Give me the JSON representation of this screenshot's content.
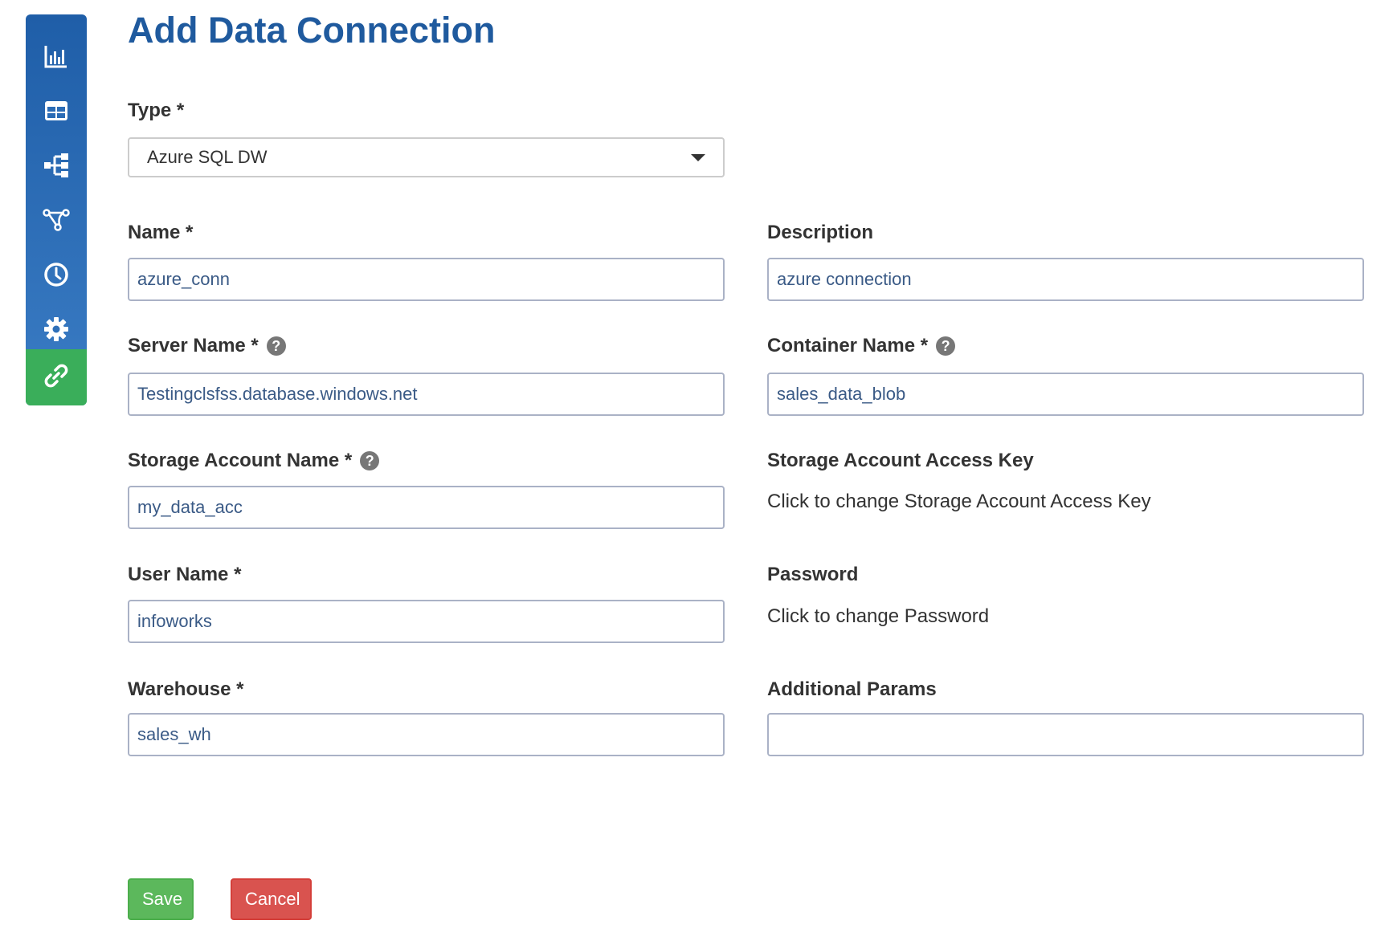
{
  "sidebar": {
    "items": [
      {
        "icon": "bar-chart-icon"
      },
      {
        "icon": "table-icon"
      },
      {
        "icon": "hierarchy-icon"
      },
      {
        "icon": "pipeline-icon"
      },
      {
        "icon": "clock-icon"
      },
      {
        "icon": "gear-icon"
      },
      {
        "icon": "link-icon",
        "active": true
      }
    ]
  },
  "page": {
    "title": "Add Data Connection"
  },
  "form": {
    "type_label": "Type *",
    "type_value": "Azure SQL DW",
    "name_label": "Name *",
    "name_value": "azure_conn",
    "description_label": "Description",
    "description_value": "azure connection",
    "server_name_label": "Server Name *",
    "server_name_value": "Testingclsfss.database.windows.net",
    "container_name_label": "Container Name *",
    "container_name_value": "sales_data_blob",
    "storage_account_name_label": "Storage Account Name *",
    "storage_account_name_value": "my_data_acc",
    "storage_access_key_label": "Storage Account Access Key",
    "storage_access_key_link": "Click to change Storage Account Access Key",
    "user_name_label": "User Name *",
    "user_name_value": "infoworks",
    "password_label": "Password",
    "password_link": "Click to change Password",
    "warehouse_label": "Warehouse *",
    "warehouse_value": "sales_wh",
    "additional_params_label": "Additional Params",
    "additional_params_value": "",
    "help_glyph": "?"
  },
  "actions": {
    "save_label": "Save",
    "cancel_label": "Cancel"
  },
  "colors": {
    "sidebar": "#2a6bb5",
    "active_nav": "#3aae5a",
    "title": "#1f5a9e",
    "save": "#5cb85c",
    "cancel": "#d9534f"
  }
}
